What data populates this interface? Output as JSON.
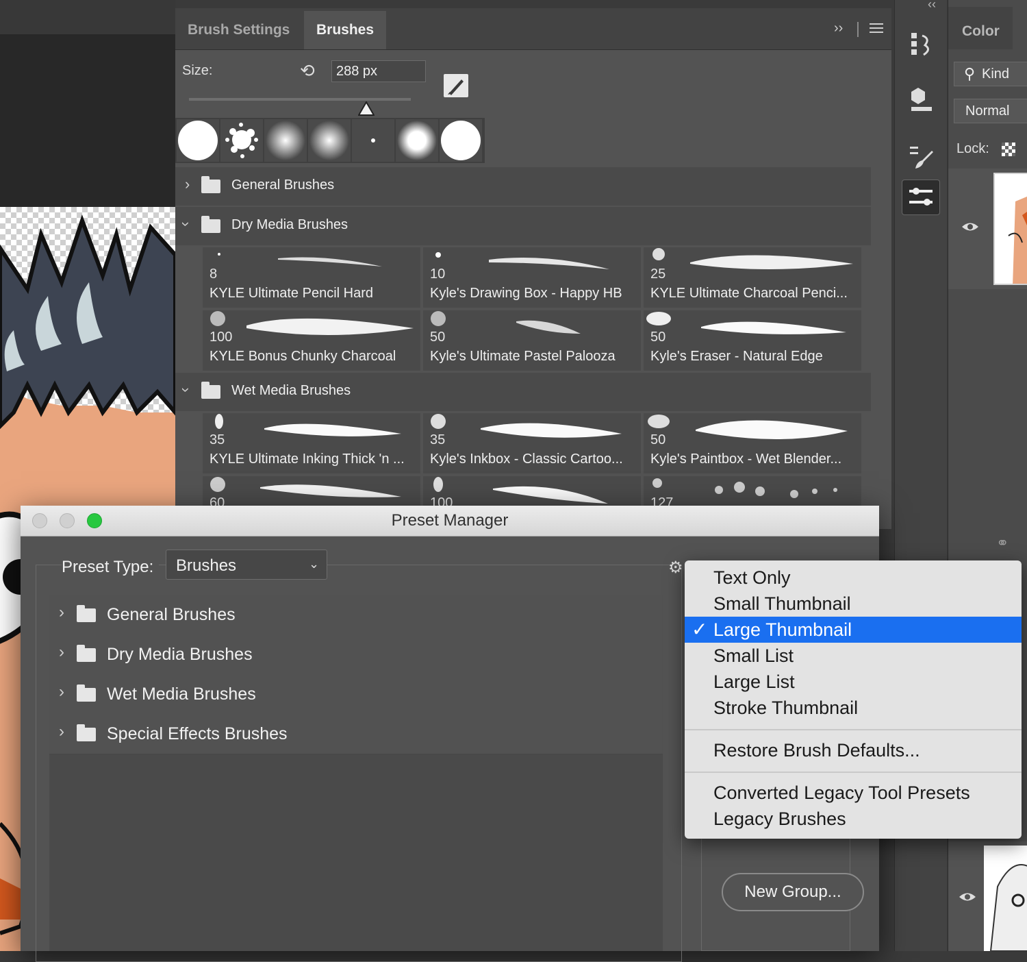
{
  "brushes_panel": {
    "tabs": [
      {
        "label": "Brush Settings"
      },
      {
        "label": "Brushes"
      }
    ],
    "size_label": "Size:",
    "size_value": "288 px",
    "size_slider_fraction": 0.8,
    "groups": [
      {
        "label": "General Brushes",
        "expanded": false
      },
      {
        "label": "Dry Media Brushes",
        "expanded": true,
        "brushes": [
          {
            "size": "8",
            "name": "KYLE Ultimate Pencil Hard"
          },
          {
            "size": "10",
            "name": "Kyle's Drawing Box - Happy HB"
          },
          {
            "size": "25",
            "name": "KYLE Ultimate Charcoal Penci..."
          },
          {
            "size": "100",
            "name": "KYLE Bonus Chunky Charcoal"
          },
          {
            "size": "50",
            "name": "Kyle's Ultimate Pastel Palooza"
          },
          {
            "size": "50",
            "name": "Kyle's Eraser - Natural Edge"
          }
        ]
      },
      {
        "label": "Wet Media Brushes",
        "expanded": true,
        "brushes": [
          {
            "size": "35",
            "name": "KYLE Ultimate Inking Thick 'n ..."
          },
          {
            "size": "35",
            "name": "Kyle's Inkbox - Classic Cartoo..."
          },
          {
            "size": "50",
            "name": "Kyle's Paintbox - Wet Blender..."
          },
          {
            "size": "60",
            "name": ""
          },
          {
            "size": "100",
            "name": ""
          },
          {
            "size": "127",
            "name": ""
          }
        ]
      }
    ]
  },
  "right_panel": {
    "color_tab": "Color",
    "kind_filter": "Kind",
    "blend_mode": "Normal",
    "lock_label": "Lock:"
  },
  "preset_manager": {
    "title": "Preset Manager",
    "preset_type_label": "Preset Type:",
    "preset_type_value": "Brushes",
    "groups": [
      {
        "label": "General Brushes"
      },
      {
        "label": "Dry Media Brushes"
      },
      {
        "label": "Wet Media Brushes"
      },
      {
        "label": "Special Effects Brushes"
      }
    ],
    "new_group_button": "New Group..."
  },
  "view_menu": {
    "items": [
      {
        "label": "Text Only",
        "selected": false
      },
      {
        "label": "Small Thumbnail",
        "selected": false
      },
      {
        "label": "Large Thumbnail",
        "selected": true
      },
      {
        "label": "Small List",
        "selected": false
      },
      {
        "label": "Large List",
        "selected": false
      },
      {
        "label": "Stroke Thumbnail",
        "selected": false
      }
    ],
    "restore": "Restore Brush Defaults...",
    "legacy_items": [
      {
        "label": "Converted Legacy Tool Presets"
      },
      {
        "label": "Legacy Brushes"
      }
    ],
    "check_glyph": "✓"
  },
  "colors": {
    "accent_selected": "#1a6ff0",
    "zoom_button": "#28c840",
    "panel_bg": "#535353"
  }
}
